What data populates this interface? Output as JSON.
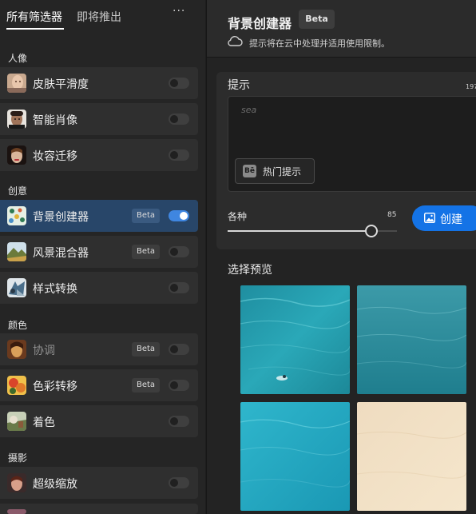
{
  "tabs": [
    {
      "label": "所有筛选器",
      "active": true
    },
    {
      "label": "即将推出",
      "active": false
    }
  ],
  "more_label": "···",
  "sections": [
    {
      "title": "人像"
    },
    {
      "title": "创意"
    },
    {
      "title": "颜色"
    },
    {
      "title": "摄影"
    }
  ],
  "filters": [
    {
      "label": "皮肤平滑度",
      "badge": "",
      "on": false,
      "thumb": "portrait-skin-icon"
    },
    {
      "label": "智能肖像",
      "badge": "",
      "on": false,
      "thumb": "portrait-smart-icon"
    },
    {
      "label": "妆容迁移",
      "badge": "",
      "on": false,
      "thumb": "portrait-makeup-icon"
    },
    {
      "label": "背景创建器",
      "badge": "Beta",
      "on": true,
      "thumb": "background-creator-icon"
    },
    {
      "label": "风景混合器",
      "badge": "Beta",
      "on": false,
      "thumb": "landscape-mixer-icon"
    },
    {
      "label": "样式转换",
      "badge": "",
      "on": false,
      "thumb": "style-transfer-icon"
    },
    {
      "label": "协调",
      "badge": "Beta",
      "on": false,
      "thumb": "harmonize-icon"
    },
    {
      "label": "色彩转移",
      "badge": "Beta",
      "on": false,
      "thumb": "color-transfer-icon"
    },
    {
      "label": "着色",
      "badge": "",
      "on": false,
      "thumb": "colorize-icon"
    },
    {
      "label": "超级缩放",
      "badge": "",
      "on": false,
      "thumb": "super-zoom-icon"
    }
  ],
  "panel": {
    "title": "背景创建器",
    "badge": "Beta",
    "note": "提示将在云中处理并适用使用限制。",
    "prompt_title": "提示",
    "prompt_count": "197",
    "prompt_text": "sea",
    "hot_prompt_label": "热门提示",
    "slider_label": "各种",
    "slider_value": 85,
    "create_label": "创建",
    "preview_title": "选择预览"
  },
  "colors": {
    "accent": "#1473e6",
    "selected_row": "#284669",
    "toggle_on": "#3f86e0"
  },
  "previews": [
    {
      "name": "sea-preview-1"
    },
    {
      "name": "sea-preview-2"
    },
    {
      "name": "sea-preview-3"
    },
    {
      "name": "sea-preview-4"
    }
  ]
}
